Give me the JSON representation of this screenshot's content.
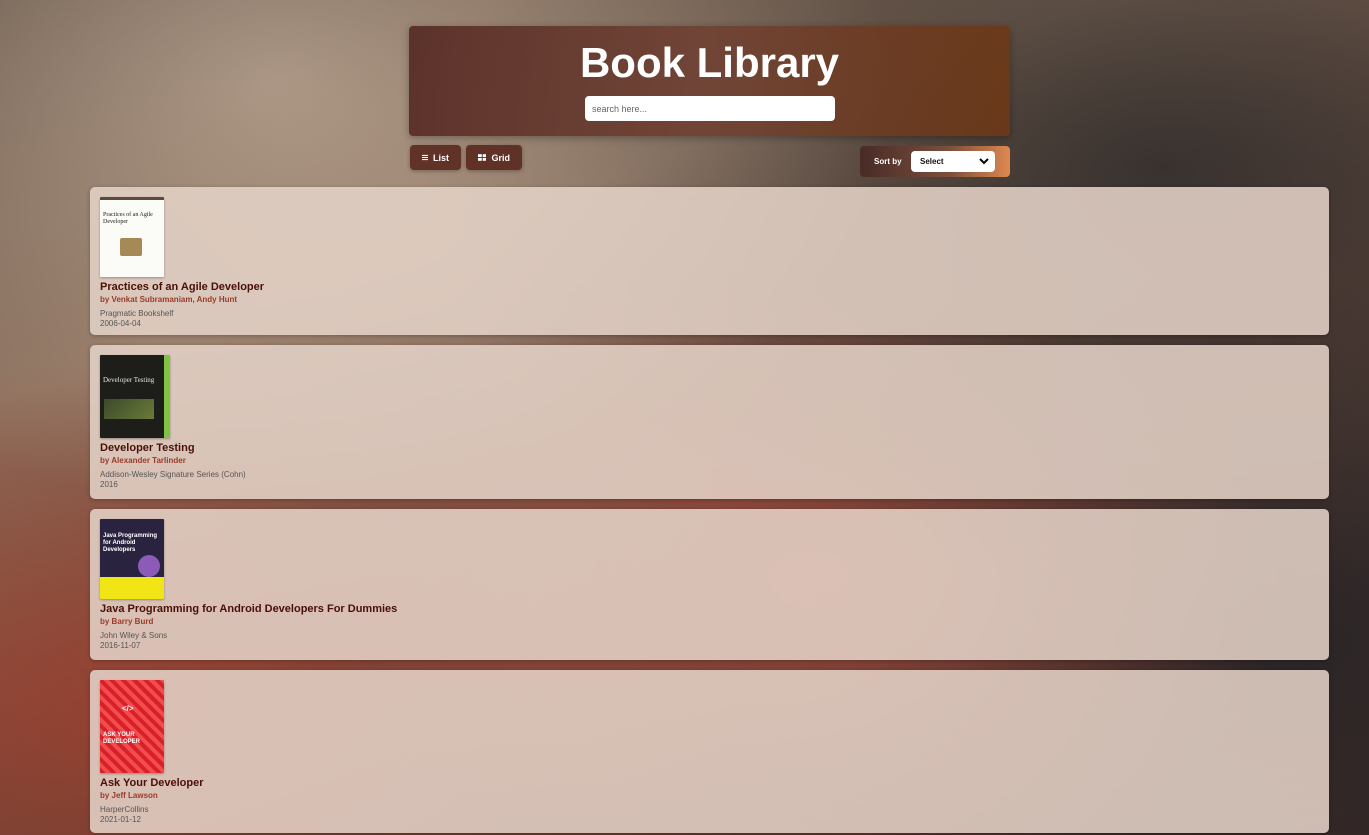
{
  "header": {
    "title": "Book Library",
    "search_placeholder": "search here..."
  },
  "view_toggle": {
    "list_label": "List",
    "grid_label": "Grid"
  },
  "sort": {
    "label": "Sort by",
    "selected": "Select"
  },
  "books": [
    {
      "title": "Practices of an Agile Developer",
      "author": "by Venkat Subramaniam, Andy Hunt",
      "publisher": "Pragmatic Bookshelf",
      "date": "2006-04-04",
      "cover_text": "Practices of an Agile Developer"
    },
    {
      "title": "Developer Testing",
      "author": "by Alexander Tarlinder",
      "publisher": "Addison-Wesley Signature Series (Cohn)",
      "date": "2016",
      "cover_text": "Developer Testing"
    },
    {
      "title": "Java Programming for Android Developers For Dummies",
      "author": "by Barry Burd",
      "publisher": "John Wiley & Sons",
      "date": "2016-11-07",
      "cover_text": "Java Programming for Android Developers"
    },
    {
      "title": "Ask Your Developer",
      "author": "by Jeff Lawson",
      "publisher": "HarperCollins",
      "date": "2021-01-12",
      "cover_text": "ASK YOUR DEVELOPER"
    }
  ]
}
